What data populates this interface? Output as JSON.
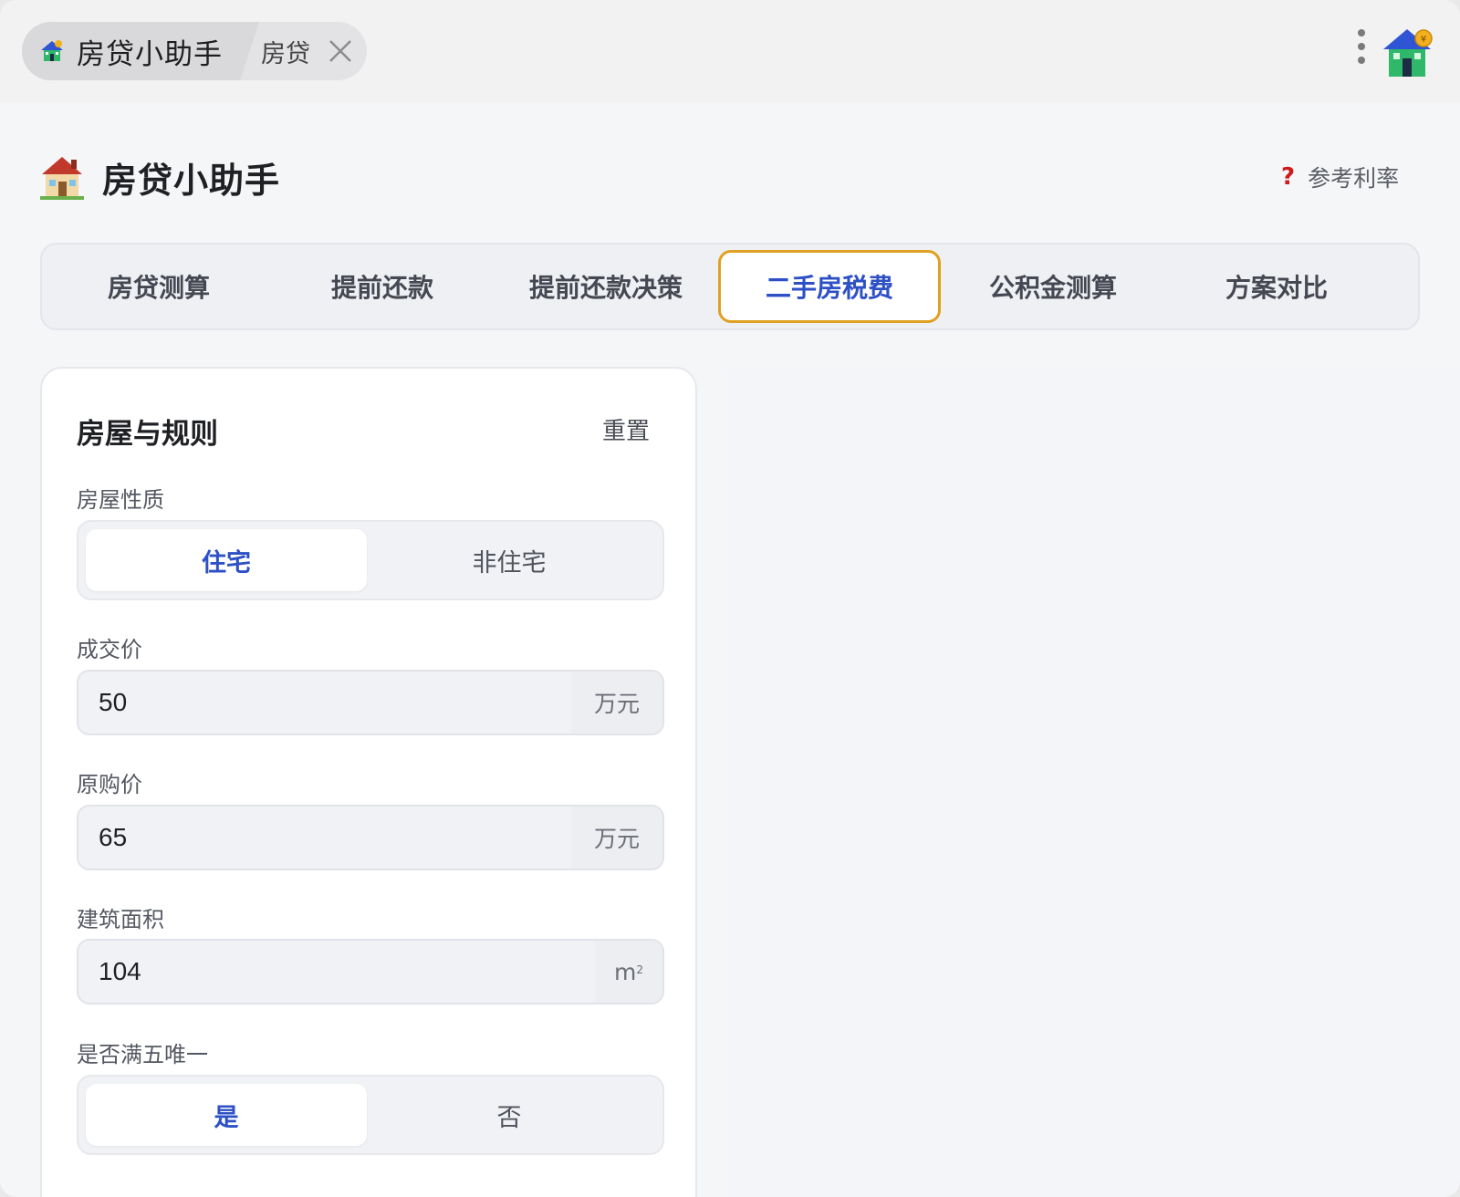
{
  "window": {
    "tab_main_label": "房贷小助手",
    "tab_second_label": "房贷"
  },
  "header": {
    "title": "房贷小助手",
    "ref_rate_icon": "?",
    "ref_rate_label": "参考利率"
  },
  "nav": {
    "tabs": [
      {
        "label": "房贷测算",
        "active": false
      },
      {
        "label": "提前还款",
        "active": false
      },
      {
        "label": "提前还款决策",
        "active": false
      },
      {
        "label": "二手房税费",
        "active": true
      },
      {
        "label": "公积金测算",
        "active": false
      },
      {
        "label": "方案对比",
        "active": false
      }
    ]
  },
  "form": {
    "title": "房屋与规则",
    "reset_label": "重置",
    "house_type": {
      "label": "房屋性质",
      "options": [
        "住宅",
        "非住宅"
      ],
      "selected": "住宅"
    },
    "deal_price": {
      "label": "成交价",
      "value": "50",
      "unit": "万元"
    },
    "original_price": {
      "label": "原购价",
      "value": "65",
      "unit": "万元"
    },
    "area": {
      "label": "建筑面积",
      "value": "104",
      "unit": "m",
      "unit_sup": "2"
    },
    "five_unique": {
      "label": "是否满五唯一",
      "options": [
        "是",
        "否"
      ],
      "selected": "是"
    }
  },
  "colors": {
    "accent": "#2d50c6",
    "active_border": "#e0a021",
    "help_icon": "#d0191b"
  },
  "icons": {
    "tab_icon": "house-icon",
    "close": "close-icon",
    "menu": "kebab-menu-icon",
    "logo": "house-coin-logo-icon",
    "title": "house-emoji-icon",
    "help": "question-mark-icon"
  }
}
